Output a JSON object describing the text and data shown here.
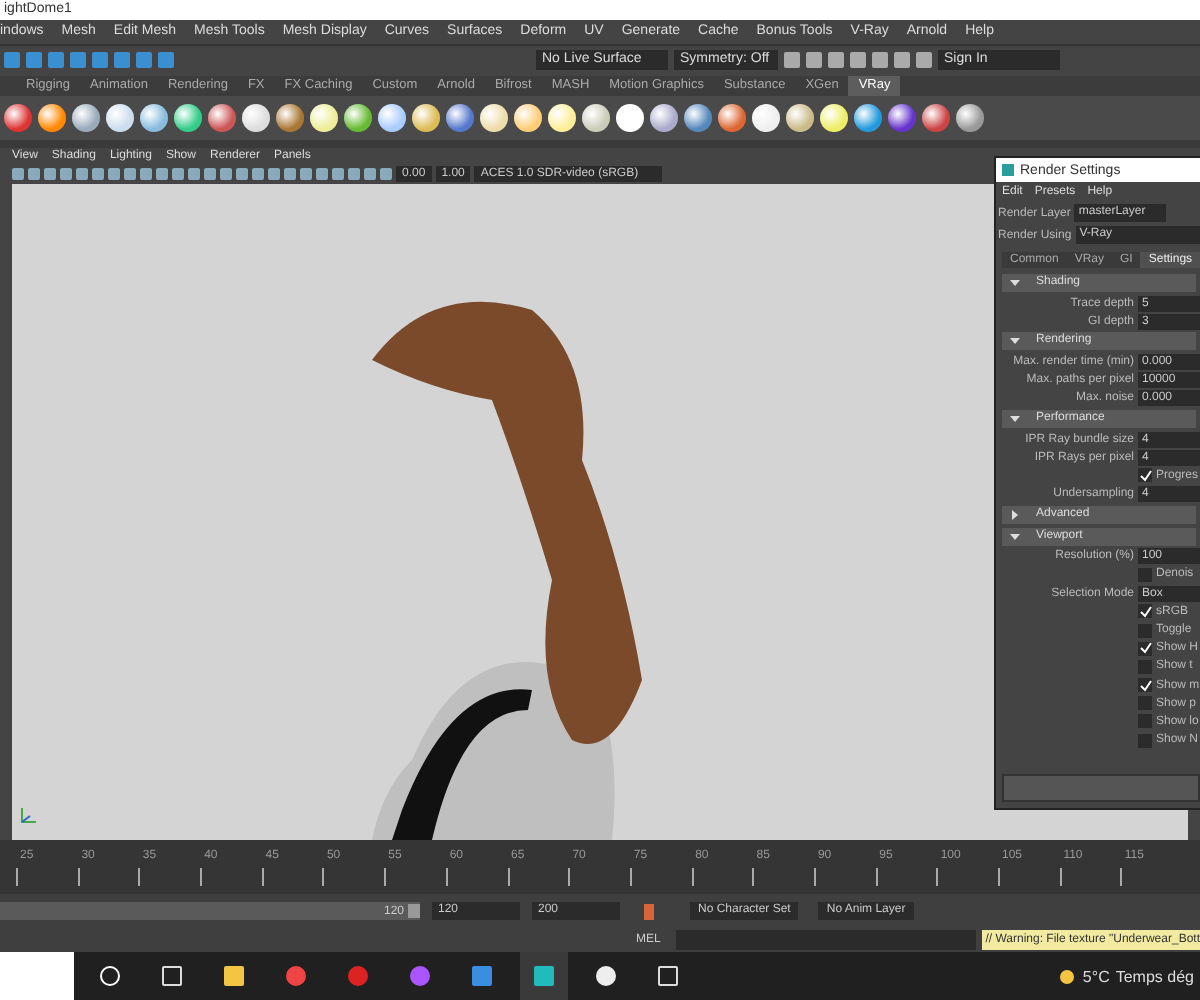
{
  "window": {
    "title": "ightDome1"
  },
  "menu_bar": [
    "indows",
    "Mesh",
    "Edit Mesh",
    "Mesh Tools",
    "Mesh Display",
    "Curves",
    "Surfaces",
    "Deform",
    "UV",
    "Generate",
    "Cache",
    "Bonus Tools",
    "V-Ray",
    "Arnold",
    "Help"
  ],
  "status_line": {
    "live_surface": "No Live Surface",
    "symmetry": "Symmetry: Off",
    "sign_in": "Sign In"
  },
  "shelf_tabs": [
    {
      "label": "Rigging",
      "selected": false
    },
    {
      "label": "Animation",
      "selected": false
    },
    {
      "label": "Rendering",
      "selected": false
    },
    {
      "label": "FX",
      "selected": false
    },
    {
      "label": "FX Caching",
      "selected": false
    },
    {
      "label": "Custom",
      "selected": false
    },
    {
      "label": "Arnold",
      "selected": false
    },
    {
      "label": "Bifrost",
      "selected": false
    },
    {
      "label": "MASH",
      "selected": false
    },
    {
      "label": "Motion Graphics",
      "selected": false
    },
    {
      "label": "Substance",
      "selected": false
    },
    {
      "label": "XGen",
      "selected": false
    },
    {
      "label": "VRay",
      "selected": true
    }
  ],
  "viewport": {
    "menu": [
      "View",
      "Shading",
      "Lighting",
      "Show",
      "Renderer",
      "Panels"
    ],
    "exposure": "0.00",
    "gamma": "1.00",
    "color_space": "ACES 1.0 SDR-video (sRGB)"
  },
  "render_settings": {
    "title": "Render Settings",
    "menu": [
      "Edit",
      "Presets",
      "Help"
    ],
    "render_layer_label": "Render Layer",
    "render_layer": "masterLayer",
    "render_using_label": "Render Using",
    "render_using": "V-Ray",
    "tabs": [
      {
        "label": "Common",
        "selected": false
      },
      {
        "label": "VRay",
        "selected": false
      },
      {
        "label": "GI",
        "selected": false
      },
      {
        "label": "Settings",
        "selected": true
      }
    ],
    "sections": [
      {
        "title": "Shading",
        "expanded": true,
        "rows": [
          {
            "kind": "number",
            "label": "Trace depth",
            "value": "5"
          },
          {
            "kind": "number",
            "label": "GI depth",
            "value": "3"
          }
        ]
      },
      {
        "title": "Rendering",
        "expanded": true,
        "rows": [
          {
            "kind": "number",
            "label": "Max. render time (min)",
            "value": "0.000"
          },
          {
            "kind": "number",
            "label": "Max. paths per pixel",
            "value": "10000"
          },
          {
            "kind": "number",
            "label": "Max. noise",
            "value": "0.000"
          }
        ]
      },
      {
        "title": "Performance",
        "expanded": true,
        "rows": [
          {
            "kind": "number",
            "label": "IPR Ray bundle size",
            "value": "4"
          },
          {
            "kind": "number",
            "label": "IPR Rays per pixel",
            "value": "4"
          },
          {
            "kind": "check",
            "label": "Progres",
            "checked": true
          },
          {
            "kind": "number",
            "label": "Undersampling",
            "value": "4"
          }
        ]
      },
      {
        "title": "Advanced",
        "expanded": false
      },
      {
        "title": "Viewport",
        "expanded": true,
        "rows": [
          {
            "kind": "number",
            "label": "Resolution (%)",
            "value": "100"
          },
          {
            "kind": "check",
            "label": "Denois",
            "checked": false
          },
          {
            "kind": "number",
            "label": "Selection Mode",
            "value": "Box"
          },
          {
            "kind": "check",
            "label": "sRGB",
            "checked": true
          },
          {
            "kind": "check",
            "label": "Toggle",
            "checked": false
          },
          {
            "kind": "check",
            "label": "Show H",
            "checked": true
          },
          {
            "kind": "check",
            "label": "Show t",
            "checked": false
          },
          {
            "kind": "check",
            "label": "Show m",
            "checked": true
          },
          {
            "kind": "check",
            "label": "Show p",
            "checked": false
          },
          {
            "kind": "check",
            "label": "Show lo",
            "checked": false
          },
          {
            "kind": "check",
            "label": "Show N",
            "checked": false
          }
        ]
      }
    ]
  },
  "time_slider": {
    "ticks": [
      "25",
      "30",
      "35",
      "40",
      "45",
      "50",
      "55",
      "60",
      "65",
      "70",
      "75",
      "80",
      "85",
      "90",
      "95",
      "100",
      "105",
      "110",
      "115"
    ]
  },
  "range_slider": {
    "level": 1,
    "end_handle": "120",
    "end_time": "120",
    "max_time": "200",
    "character_set": "No Character Set",
    "anim_layer": "No Anim Layer"
  },
  "command_line": {
    "language": "MEL",
    "warning": "// Warning: File texture \"Underwear_Bott"
  },
  "taskbar": {
    "apps": [
      {
        "kind": "circle",
        "selected": false
      },
      {
        "kind": "taskview",
        "selected": false
      },
      {
        "kind": "folder",
        "selected": false
      },
      {
        "kind": "chrome",
        "selected": false
      },
      {
        "kind": "opera",
        "selected": false
      },
      {
        "kind": "messenger",
        "selected": false
      },
      {
        "kind": "photos",
        "selected": false
      },
      {
        "kind": "maya",
        "selected": true
      },
      {
        "kind": "unreal",
        "selected": false
      },
      {
        "kind": "cube",
        "selected": false
      }
    ],
    "temperature": "5°C",
    "weather": "Temps dég"
  }
}
